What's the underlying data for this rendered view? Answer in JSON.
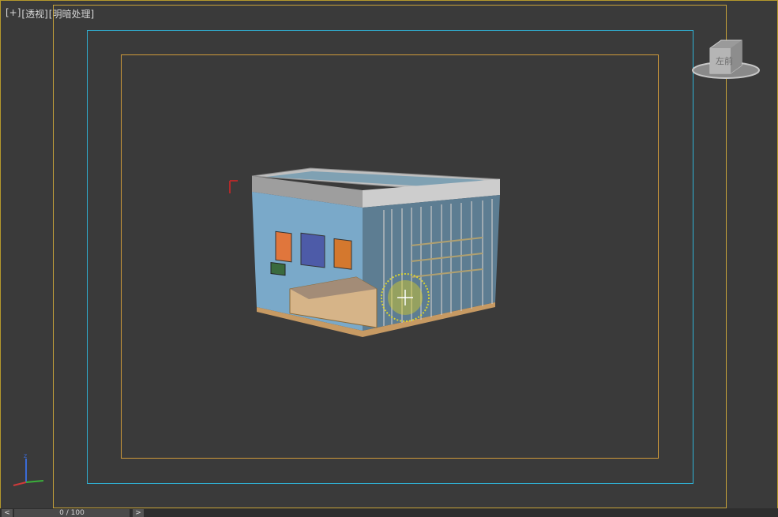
{
  "viewport": {
    "label_plus": "[+]",
    "label_view": "[透视]",
    "label_shading": "[明暗处理]"
  },
  "viewcube": {
    "face_label": "左前",
    "icon": "viewcube-icon"
  },
  "axis": {
    "z": "z",
    "x": "x",
    "y": "y"
  },
  "timeline": {
    "frame_text": "0 / 100",
    "prev_icon": "<",
    "next_icon": ">"
  },
  "colors": {
    "safe_frame": "#c8a43a",
    "action_frame": "#2fb2d6",
    "title_frame": "#d09a3a",
    "viewport_bg": "#3a3a3a",
    "light_gizmo": "#e6dc28"
  }
}
